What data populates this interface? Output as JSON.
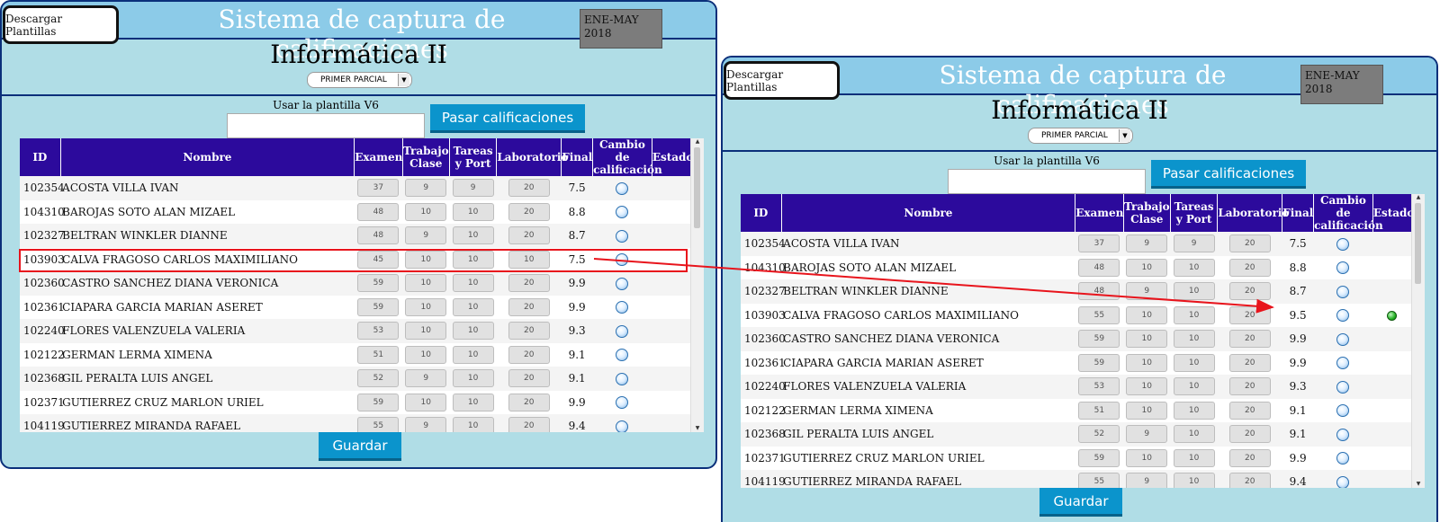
{
  "arrow_color": "#e8141c",
  "accent_color": "#0b94cc",
  "header_color": "#2c0a9c",
  "panels": [
    {
      "download_label": "Descargar Plantillas",
      "system_title": "Sistema de captura de calificaciones",
      "period": "ENE-MAY\n2018",
      "subject": "Informática II",
      "parcial_selected": "PRIMER PARCIAL",
      "template_label": "Usar la plantilla V6",
      "template_value": "",
      "pass_button": "Pasar calificaciones",
      "save_button": "Guardar",
      "columns": [
        "ID",
        "Nombre",
        "Examen",
        "Trabajo Clase",
        "Tareas y Port",
        "Laboratorio",
        "Final",
        "Cambio de calificación",
        "Estado"
      ],
      "rows": [
        {
          "id": "102354",
          "name": "ACOSTA VILLA IVAN",
          "exam": "37",
          "work": "9",
          "tasks": "9",
          "lab": "20",
          "final": "7.5",
          "status": ""
        },
        {
          "id": "104310",
          "name": "BAROJAS SOTO ALAN MIZAEL",
          "exam": "48",
          "work": "10",
          "tasks": "10",
          "lab": "20",
          "final": "8.8",
          "status": ""
        },
        {
          "id": "102327",
          "name": "BELTRAN WINKLER DIANNE",
          "exam": "48",
          "work": "9",
          "tasks": "10",
          "lab": "20",
          "final": "8.7",
          "status": ""
        },
        {
          "id": "103903",
          "name": "CALVA FRAGOSO CARLOS MAXIMILIANO",
          "exam": "45",
          "work": "10",
          "tasks": "10",
          "lab": "10",
          "final": "7.5",
          "status": ""
        },
        {
          "id": "102360",
          "name": "CASTRO SANCHEZ DIANA VERONICA",
          "exam": "59",
          "work": "10",
          "tasks": "10",
          "lab": "20",
          "final": "9.9",
          "status": ""
        },
        {
          "id": "102361",
          "name": "CIAPARA GARCIA MARIAN ASERET",
          "exam": "59",
          "work": "10",
          "tasks": "10",
          "lab": "20",
          "final": "9.9",
          "status": ""
        },
        {
          "id": "102240",
          "name": "FLORES VALENZUELA VALERIA",
          "exam": "53",
          "work": "10",
          "tasks": "10",
          "lab": "20",
          "final": "9.3",
          "status": ""
        },
        {
          "id": "102122",
          "name": "GERMAN LERMA XIMENA",
          "exam": "51",
          "work": "10",
          "tasks": "10",
          "lab": "20",
          "final": "9.1",
          "status": ""
        },
        {
          "id": "102368",
          "name": "GIL PERALTA LUIS ANGEL",
          "exam": "52",
          "work": "9",
          "tasks": "10",
          "lab": "20",
          "final": "9.1",
          "status": ""
        },
        {
          "id": "102371",
          "name": "GUTIERREZ CRUZ MARLON URIEL",
          "exam": "59",
          "work": "10",
          "tasks": "10",
          "lab": "20",
          "final": "9.9",
          "status": ""
        },
        {
          "id": "104119",
          "name": "GUTIERREZ MIRANDA RAFAEL",
          "exam": "55",
          "work": "9",
          "tasks": "10",
          "lab": "20",
          "final": "9.4",
          "status": ""
        }
      ]
    },
    {
      "download_label": "Descargar Plantillas",
      "system_title": "Sistema de captura de calificaciones",
      "period": "ENE-MAY\n2018",
      "subject": "Informática II",
      "parcial_selected": "PRIMER PARCIAL",
      "template_label": "Usar la plantilla V6",
      "template_value": "",
      "pass_button": "Pasar calificaciones",
      "save_button": "Guardar",
      "columns": [
        "ID",
        "Nombre",
        "Examen",
        "Trabajo Clase",
        "Tareas y Port",
        "Laboratorio",
        "Final",
        "Cambio de calificación",
        "Estado"
      ],
      "rows": [
        {
          "id": "102354",
          "name": "ACOSTA VILLA IVAN",
          "exam": "37",
          "work": "9",
          "tasks": "9",
          "lab": "20",
          "final": "7.5",
          "status": ""
        },
        {
          "id": "104310",
          "name": "BAROJAS SOTO ALAN MIZAEL",
          "exam": "48",
          "work": "10",
          "tasks": "10",
          "lab": "20",
          "final": "8.8",
          "status": ""
        },
        {
          "id": "102327",
          "name": "BELTRAN WINKLER DIANNE",
          "exam": "48",
          "work": "9",
          "tasks": "10",
          "lab": "20",
          "final": "8.7",
          "status": ""
        },
        {
          "id": "103903",
          "name": "CALVA FRAGOSO CARLOS MAXIMILIANO",
          "exam": "55",
          "work": "10",
          "tasks": "10",
          "lab": "20",
          "final": "9.5",
          "status": "green-status-dot"
        },
        {
          "id": "102360",
          "name": "CASTRO SANCHEZ DIANA VERONICA",
          "exam": "59",
          "work": "10",
          "tasks": "10",
          "lab": "20",
          "final": "9.9",
          "status": ""
        },
        {
          "id": "102361",
          "name": "CIAPARA GARCIA MARIAN ASERET",
          "exam": "59",
          "work": "10",
          "tasks": "10",
          "lab": "20",
          "final": "9.9",
          "status": ""
        },
        {
          "id": "102240",
          "name": "FLORES VALENZUELA VALERIA",
          "exam": "53",
          "work": "10",
          "tasks": "10",
          "lab": "20",
          "final": "9.3",
          "status": ""
        },
        {
          "id": "102122",
          "name": "GERMAN LERMA XIMENA",
          "exam": "51",
          "work": "10",
          "tasks": "10",
          "lab": "20",
          "final": "9.1",
          "status": ""
        },
        {
          "id": "102368",
          "name": "GIL PERALTA LUIS ANGEL",
          "exam": "52",
          "work": "9",
          "tasks": "10",
          "lab": "20",
          "final": "9.1",
          "status": ""
        },
        {
          "id": "102371",
          "name": "GUTIERREZ CRUZ MARLON URIEL",
          "exam": "59",
          "work": "10",
          "tasks": "10",
          "lab": "20",
          "final": "9.9",
          "status": ""
        },
        {
          "id": "104119",
          "name": "GUTIERREZ MIRANDA RAFAEL",
          "exam": "55",
          "work": "9",
          "tasks": "10",
          "lab": "20",
          "final": "9.4",
          "status": ""
        }
      ]
    }
  ]
}
